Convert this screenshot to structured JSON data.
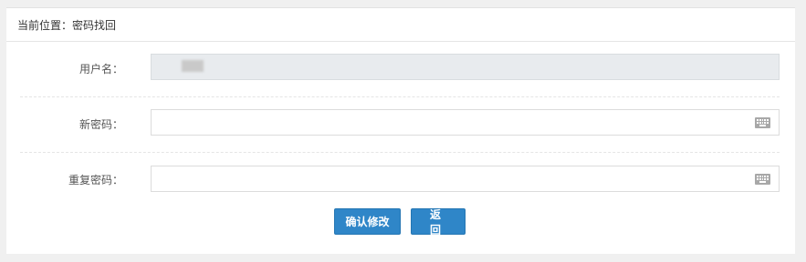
{
  "breadcrumb": {
    "text": "当前位置：密码找回"
  },
  "form": {
    "username": {
      "label": "用户名："
    },
    "new_password": {
      "label": "新密码："
    },
    "repeat_password": {
      "label": "重复密码："
    }
  },
  "buttons": {
    "confirm_label": "确认修改",
    "back_label": "返回"
  },
  "icons": {
    "keyboard": "keyboard-icon"
  },
  "colors": {
    "primary_button": "#2f86c8",
    "readonly_field": "#e8ebee",
    "page_background": "#f0f0f0"
  }
}
